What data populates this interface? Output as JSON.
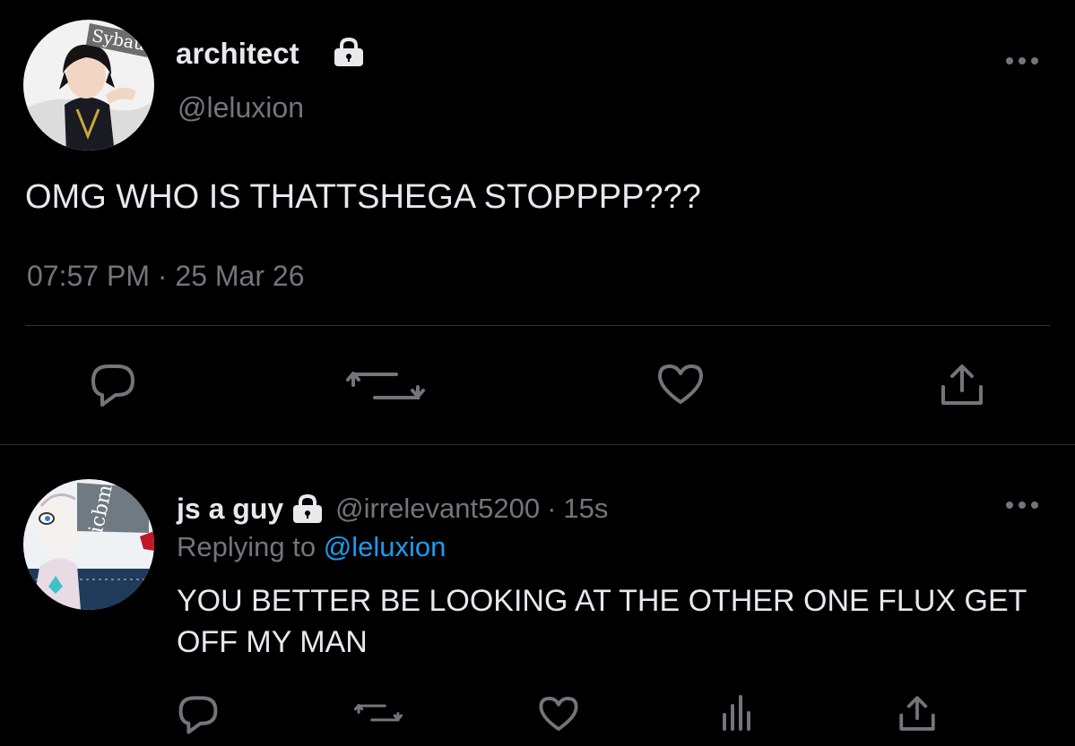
{
  "main_tweet": {
    "display_name": "architect",
    "handle": "@leluxion",
    "avatar_banner_text": "Sybau",
    "text": "OMG WHO IS THATTSHEGA STOPPPP???",
    "timestamp": "07:57 PM · 25 Mar 26",
    "actions": [
      "reply-icon",
      "retweet-icon",
      "like-icon",
      "share-icon"
    ]
  },
  "reply_tweet": {
    "display_name": "js a guy",
    "handle": "@irrelevant5200",
    "separator": "·",
    "time": "15s",
    "replying_prefix": "Replying to",
    "replying_to": "@leluxion",
    "avatar_banner_text": "icbmfe",
    "text": "YOU BETTER BE LOOKING AT THE OTHER ONE FLUX GET OFF MY MAN",
    "actions": [
      "reply-icon",
      "retweet-icon",
      "like-icon",
      "analytics-icon",
      "share-icon"
    ]
  },
  "colors": {
    "background": "#000000",
    "primary_text": "#e7e9ea",
    "secondary_text": "#71767b",
    "link": "#1d9bf0",
    "divider": "#2f3336"
  }
}
